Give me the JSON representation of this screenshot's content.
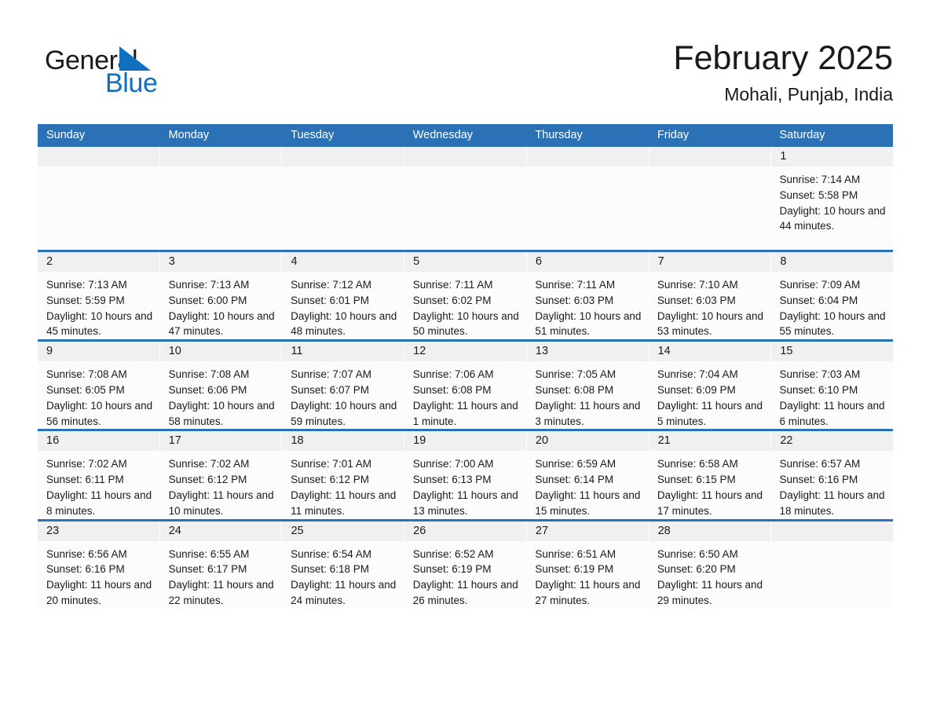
{
  "brand": {
    "name_part1": "General",
    "name_part2": "Blue",
    "accent_color": "#1170bd"
  },
  "header": {
    "title": "February 2025",
    "subtitle": "Mohali, Punjab, India"
  },
  "theme": {
    "header_blue": "#2a72b5",
    "daynum_band": "#f0f0f0",
    "cell_background": "#fcfcfd"
  },
  "calendar": {
    "weekday_headers": [
      "Sunday",
      "Monday",
      "Tuesday",
      "Wednesday",
      "Thursday",
      "Friday",
      "Saturday"
    ],
    "weeks": [
      {
        "days": [
          {
            "num": "",
            "sunrise": "",
            "sunset": "",
            "daylight": ""
          },
          {
            "num": "",
            "sunrise": "",
            "sunset": "",
            "daylight": ""
          },
          {
            "num": "",
            "sunrise": "",
            "sunset": "",
            "daylight": ""
          },
          {
            "num": "",
            "sunrise": "",
            "sunset": "",
            "daylight": ""
          },
          {
            "num": "",
            "sunrise": "",
            "sunset": "",
            "daylight": ""
          },
          {
            "num": "",
            "sunrise": "",
            "sunset": "",
            "daylight": ""
          },
          {
            "num": "1",
            "sunrise": "Sunrise: 7:14 AM",
            "sunset": "Sunset: 5:58 PM",
            "daylight": "Daylight: 10 hours and 44 minutes."
          }
        ]
      },
      {
        "days": [
          {
            "num": "2",
            "sunrise": "Sunrise: 7:13 AM",
            "sunset": "Sunset: 5:59 PM",
            "daylight": "Daylight: 10 hours and 45 minutes."
          },
          {
            "num": "3",
            "sunrise": "Sunrise: 7:13 AM",
            "sunset": "Sunset: 6:00 PM",
            "daylight": "Daylight: 10 hours and 47 minutes."
          },
          {
            "num": "4",
            "sunrise": "Sunrise: 7:12 AM",
            "sunset": "Sunset: 6:01 PM",
            "daylight": "Daylight: 10 hours and 48 minutes."
          },
          {
            "num": "5",
            "sunrise": "Sunrise: 7:11 AM",
            "sunset": "Sunset: 6:02 PM",
            "daylight": "Daylight: 10 hours and 50 minutes."
          },
          {
            "num": "6",
            "sunrise": "Sunrise: 7:11 AM",
            "sunset": "Sunset: 6:03 PM",
            "daylight": "Daylight: 10 hours and 51 minutes."
          },
          {
            "num": "7",
            "sunrise": "Sunrise: 7:10 AM",
            "sunset": "Sunset: 6:03 PM",
            "daylight": "Daylight: 10 hours and 53 minutes."
          },
          {
            "num": "8",
            "sunrise": "Sunrise: 7:09 AM",
            "sunset": "Sunset: 6:04 PM",
            "daylight": "Daylight: 10 hours and 55 minutes."
          }
        ]
      },
      {
        "days": [
          {
            "num": "9",
            "sunrise": "Sunrise: 7:08 AM",
            "sunset": "Sunset: 6:05 PM",
            "daylight": "Daylight: 10 hours and 56 minutes."
          },
          {
            "num": "10",
            "sunrise": "Sunrise: 7:08 AM",
            "sunset": "Sunset: 6:06 PM",
            "daylight": "Daylight: 10 hours and 58 minutes."
          },
          {
            "num": "11",
            "sunrise": "Sunrise: 7:07 AM",
            "sunset": "Sunset: 6:07 PM",
            "daylight": "Daylight: 10 hours and 59 minutes."
          },
          {
            "num": "12",
            "sunrise": "Sunrise: 7:06 AM",
            "sunset": "Sunset: 6:08 PM",
            "daylight": "Daylight: 11 hours and 1 minute."
          },
          {
            "num": "13",
            "sunrise": "Sunrise: 7:05 AM",
            "sunset": "Sunset: 6:08 PM",
            "daylight": "Daylight: 11 hours and 3 minutes."
          },
          {
            "num": "14",
            "sunrise": "Sunrise: 7:04 AM",
            "sunset": "Sunset: 6:09 PM",
            "daylight": "Daylight: 11 hours and 5 minutes."
          },
          {
            "num": "15",
            "sunrise": "Sunrise: 7:03 AM",
            "sunset": "Sunset: 6:10 PM",
            "daylight": "Daylight: 11 hours and 6 minutes."
          }
        ]
      },
      {
        "days": [
          {
            "num": "16",
            "sunrise": "Sunrise: 7:02 AM",
            "sunset": "Sunset: 6:11 PM",
            "daylight": "Daylight: 11 hours and 8 minutes."
          },
          {
            "num": "17",
            "sunrise": "Sunrise: 7:02 AM",
            "sunset": "Sunset: 6:12 PM",
            "daylight": "Daylight: 11 hours and 10 minutes."
          },
          {
            "num": "18",
            "sunrise": "Sunrise: 7:01 AM",
            "sunset": "Sunset: 6:12 PM",
            "daylight": "Daylight: 11 hours and 11 minutes."
          },
          {
            "num": "19",
            "sunrise": "Sunrise: 7:00 AM",
            "sunset": "Sunset: 6:13 PM",
            "daylight": "Daylight: 11 hours and 13 minutes."
          },
          {
            "num": "20",
            "sunrise": "Sunrise: 6:59 AM",
            "sunset": "Sunset: 6:14 PM",
            "daylight": "Daylight: 11 hours and 15 minutes."
          },
          {
            "num": "21",
            "sunrise": "Sunrise: 6:58 AM",
            "sunset": "Sunset: 6:15 PM",
            "daylight": "Daylight: 11 hours and 17 minutes."
          },
          {
            "num": "22",
            "sunrise": "Sunrise: 6:57 AM",
            "sunset": "Sunset: 6:16 PM",
            "daylight": "Daylight: 11 hours and 18 minutes."
          }
        ]
      },
      {
        "days": [
          {
            "num": "23",
            "sunrise": "Sunrise: 6:56 AM",
            "sunset": "Sunset: 6:16 PM",
            "daylight": "Daylight: 11 hours and 20 minutes."
          },
          {
            "num": "24",
            "sunrise": "Sunrise: 6:55 AM",
            "sunset": "Sunset: 6:17 PM",
            "daylight": "Daylight: 11 hours and 22 minutes."
          },
          {
            "num": "25",
            "sunrise": "Sunrise: 6:54 AM",
            "sunset": "Sunset: 6:18 PM",
            "daylight": "Daylight: 11 hours and 24 minutes."
          },
          {
            "num": "26",
            "sunrise": "Sunrise: 6:52 AM",
            "sunset": "Sunset: 6:19 PM",
            "daylight": "Daylight: 11 hours and 26 minutes."
          },
          {
            "num": "27",
            "sunrise": "Sunrise: 6:51 AM",
            "sunset": "Sunset: 6:19 PM",
            "daylight": "Daylight: 11 hours and 27 minutes."
          },
          {
            "num": "28",
            "sunrise": "Sunrise: 6:50 AM",
            "sunset": "Sunset: 6:20 PM",
            "daylight": "Daylight: 11 hours and 29 minutes."
          },
          {
            "num": "",
            "sunrise": "",
            "sunset": "",
            "daylight": ""
          }
        ]
      }
    ]
  }
}
